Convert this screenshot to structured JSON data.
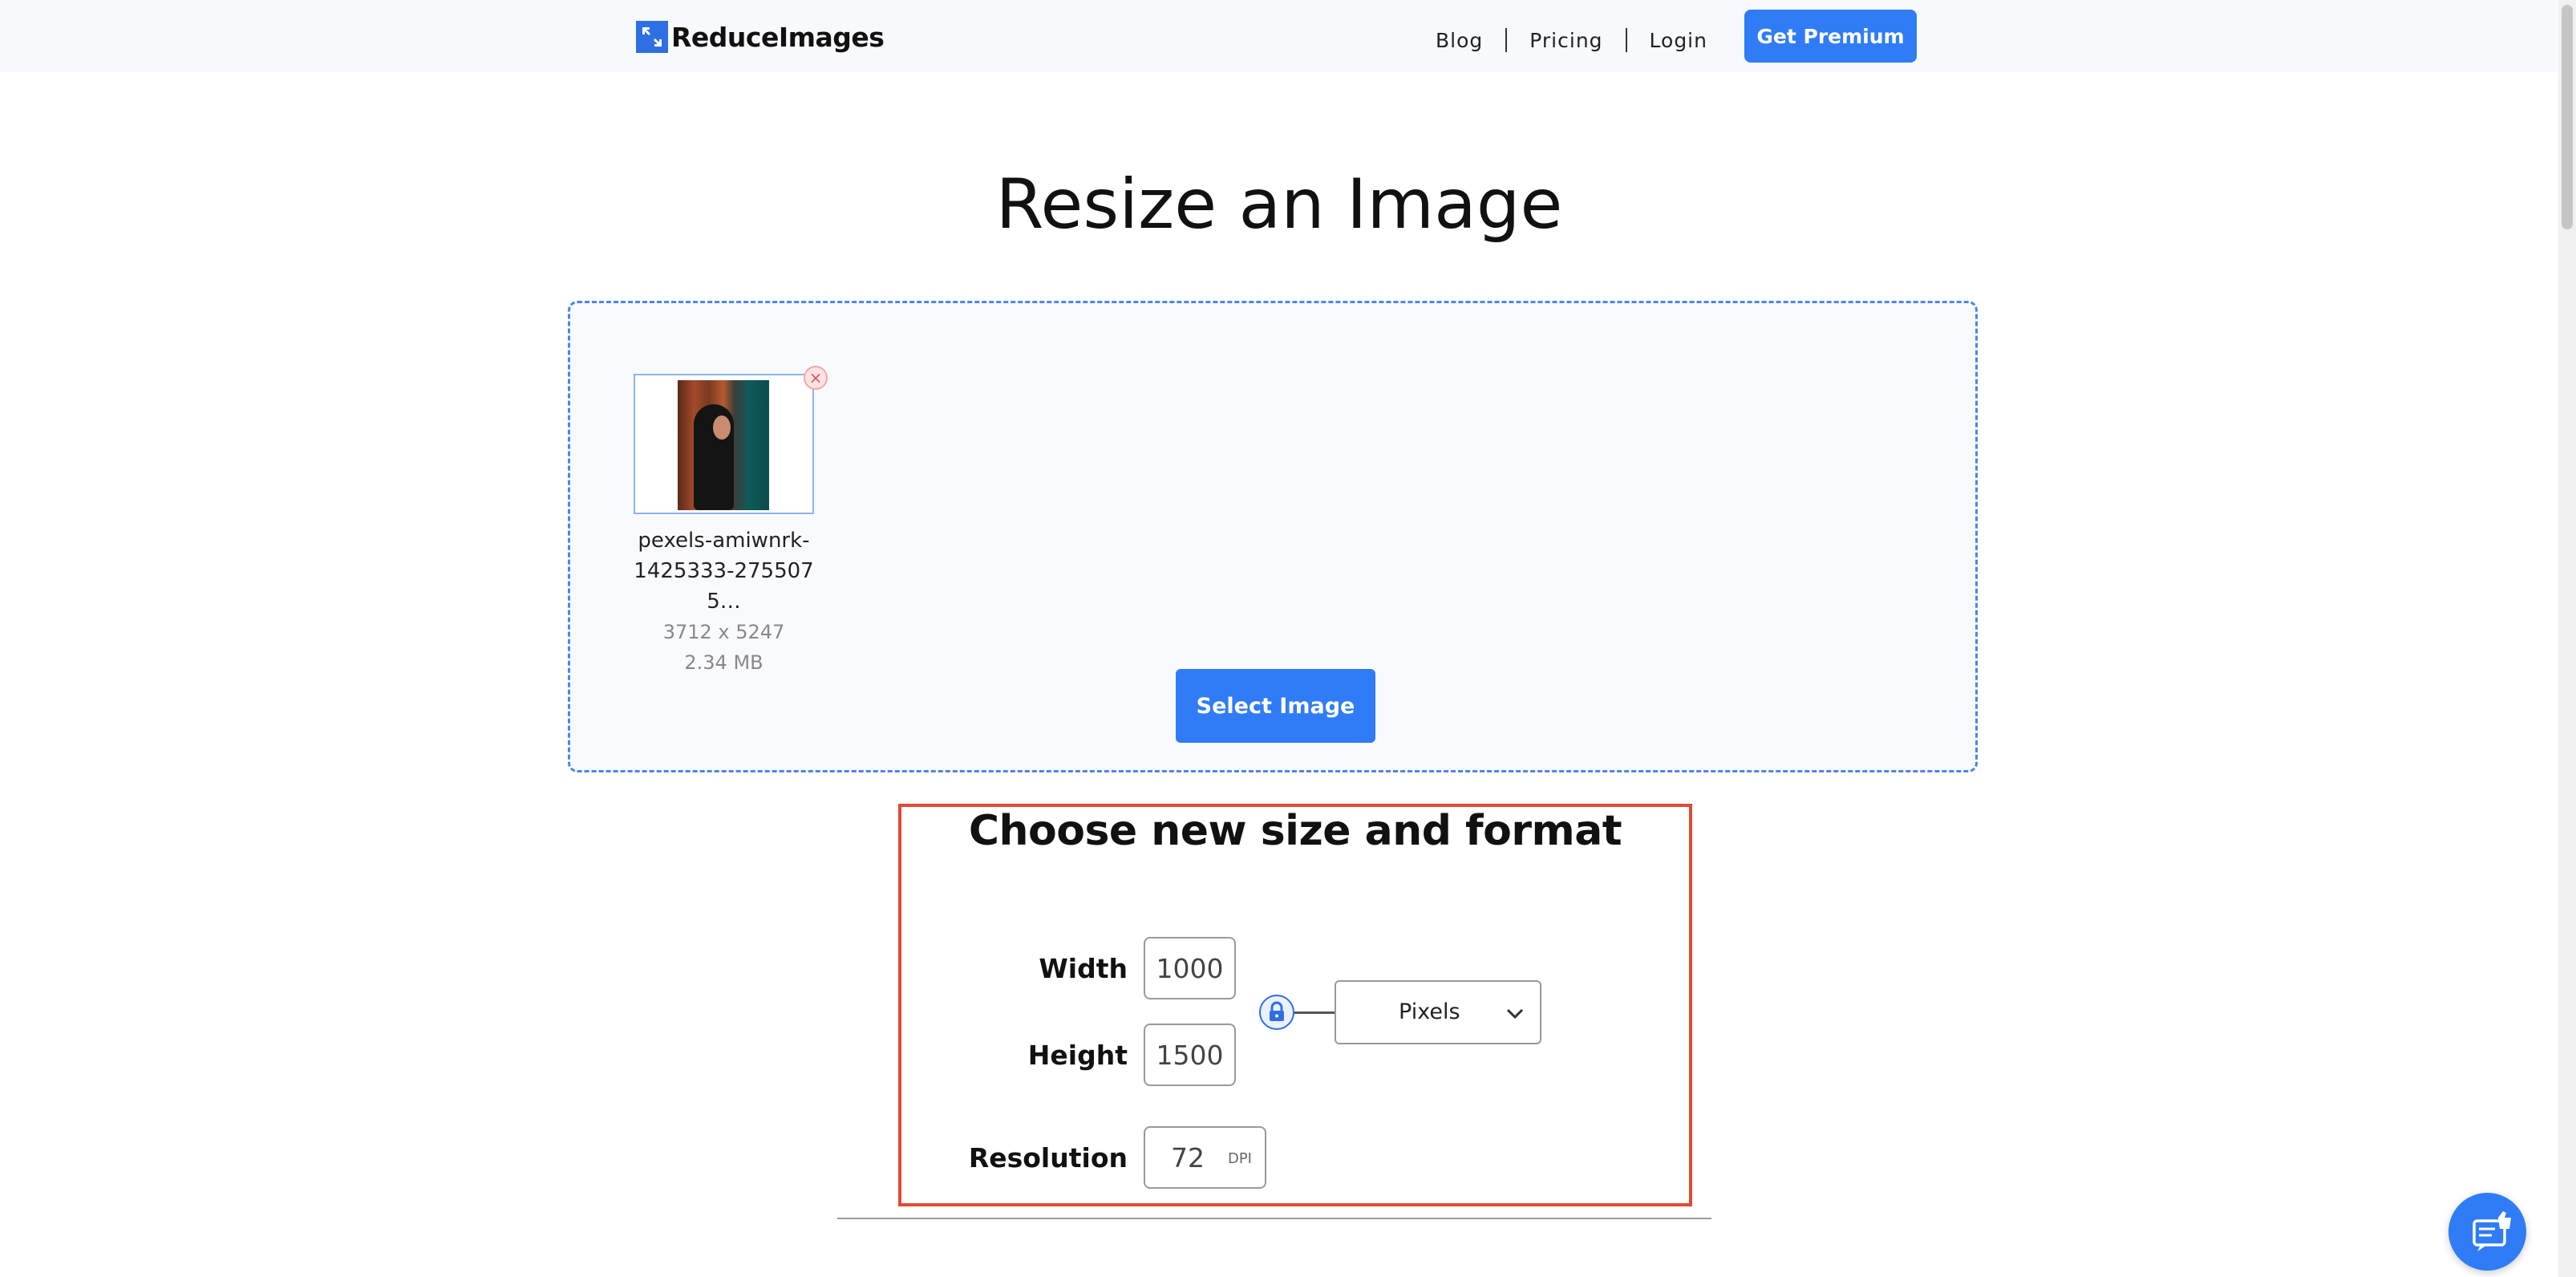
{
  "header": {
    "logo_text": "ReduceImages",
    "nav": {
      "blog": "Blog",
      "pricing": "Pricing",
      "login": "Login"
    },
    "premium_label": "Get Premium"
  },
  "main": {
    "title": "Resize an Image",
    "file": {
      "name": "pexels-amiwnrk-1425333-2755075…",
      "dimensions": "3712 x 5247",
      "size": "2.34 MB",
      "remove_glyph": "×"
    },
    "select_label": "Select Image"
  },
  "options": {
    "title": "Choose new size and format",
    "width_label": "Width",
    "width_value": "1000",
    "height_label": "Height",
    "height_value": "1500",
    "resolution_label": "Resolution",
    "resolution_value": "72",
    "resolution_unit": "DPI",
    "unit_selected": "Pixels"
  },
  "colors": {
    "accent": "#2f7cf6",
    "highlight": "#e04a34",
    "dash": "#4b86e8"
  },
  "icons": [
    "logo-icon",
    "remove-icon",
    "lock-icon",
    "chevron-down-icon",
    "chat-icon"
  ]
}
